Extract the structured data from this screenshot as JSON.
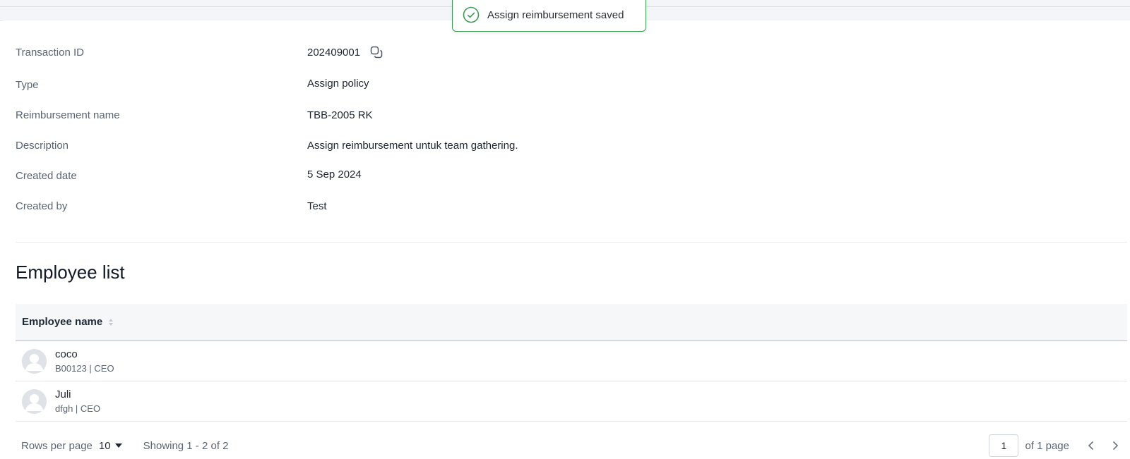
{
  "toast": {
    "message": "Assign reimbursement saved",
    "icon": "check-circle-icon",
    "color": "#3f9a55"
  },
  "details": [
    {
      "label": "Transaction ID",
      "value": "202409001"
    },
    {
      "label": "Type",
      "value": "Assign policy"
    },
    {
      "label": "Reimbursement name",
      "value": "TBB-2005 RK"
    },
    {
      "label": "Description",
      "value": "Assign reimbursement untuk team gathering."
    },
    {
      "label": "Created date",
      "value": "5 Sep 2024"
    },
    {
      "label": "Created by",
      "value": "Test"
    }
  ],
  "employee_list": {
    "title": "Employee list",
    "column_header": "Employee name",
    "rows": [
      {
        "name": "coco",
        "sub": "B00123 | CEO"
      },
      {
        "name": "Juli",
        "sub": "dfgh | CEO"
      }
    ]
  },
  "pagination": {
    "rows_per_page_label": "Rows per page",
    "rows_per_page_value": "10",
    "showing_text": "Showing 1 - 2 of 2",
    "current_page": "1",
    "of_pages_text": "of 1 page"
  }
}
